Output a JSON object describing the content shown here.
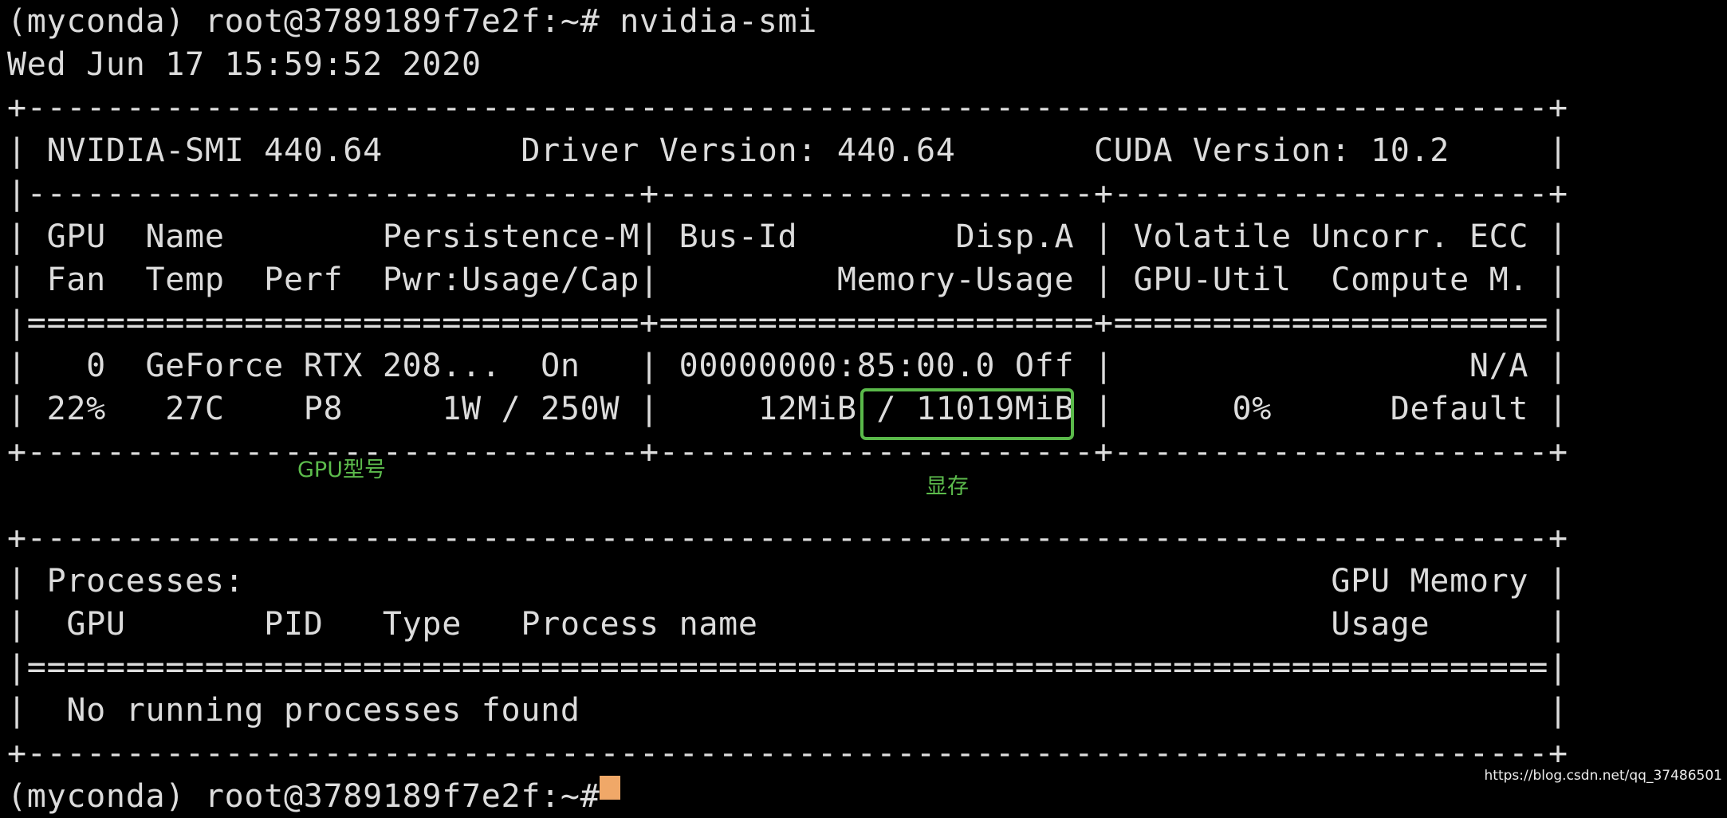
{
  "terminal": {
    "lines": [
      "(myconda) root@3789189f7e2f:~# nvidia-smi",
      "Wed Jun 17 15:59:52 2020",
      "+-----------------------------------------------------------------------------+",
      "| NVIDIA-SMI 440.64       Driver Version: 440.64       CUDA Version: 10.2     |",
      "|-------------------------------+----------------------+----------------------+",
      "| GPU  Name        Persistence-M| Bus-Id        Disp.A | Volatile Uncorr. ECC |",
      "| Fan  Temp  Perf  Pwr:Usage/Cap|         Memory-Usage | GPU-Util  Compute M. |",
      "|===============================+======================+======================|",
      "|   0  GeForce RTX 208...  On   | 00000000:85:00.0 Off |                  N/A |",
      "| 22%   27C    P8     1W / 250W |     12MiB / 11019MiB |      0%      Default |",
      "+-------------------------------+----------------------+----------------------+",
      "",
      "+-----------------------------------------------------------------------------+",
      "| Processes:                                                       GPU Memory |",
      "|  GPU       PID   Type   Process name                             Usage      |",
      "|=============================================================================|",
      "|  No running processes found                                                 |",
      "+-----------------------------------------------------------------------------+",
      "(myconda) root@3789189f7e2f:~# "
    ]
  },
  "annotations": {
    "gpu_model": "GPU型号",
    "memory": "显存"
  },
  "watermark": "https://blog.csdn.net/qq_37486501",
  "colors": {
    "background": "#000000",
    "text": "#dcdcdc",
    "annotation": "#5cbb4c",
    "cursor": "#f0a868"
  }
}
